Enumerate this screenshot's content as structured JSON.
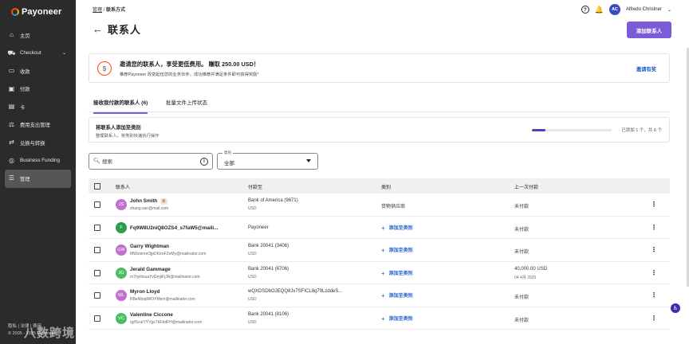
{
  "brand": {
    "name": "Payoneer"
  },
  "sidebar": {
    "items": [
      {
        "label": "主页",
        "icon": "home-icon",
        "glyph": "⌂"
      },
      {
        "label": "Checkout",
        "icon": "cart-icon",
        "glyph": "⛟",
        "chevron": "⌄"
      },
      {
        "label": "收款",
        "icon": "receive-icon",
        "glyph": "▭"
      },
      {
        "label": "付款",
        "icon": "pay-icon",
        "glyph": "▣"
      },
      {
        "label": "卡",
        "icon": "card-icon",
        "glyph": "▤"
      },
      {
        "label": "费用支出管理",
        "icon": "expense-icon",
        "glyph": "⚖"
      },
      {
        "label": "兑换与转换",
        "icon": "exchange-icon",
        "glyph": "⇄"
      },
      {
        "label": "Business Funding",
        "icon": "funding-icon",
        "glyph": "◎"
      },
      {
        "label": "管理",
        "icon": "manage-icon",
        "glyph": "☰"
      }
    ],
    "footer_line1": "隐私 | 法律 | 费用",
    "footer_line2": "© 2005 - 2025 Payoneer",
    "watermark": "八数跨境"
  },
  "breadcrumb": {
    "parent": "管理",
    "separator": " / ",
    "current": "联系方式"
  },
  "page_title": "联系人",
  "back_glyph": "←",
  "topbar": {
    "help": "?",
    "bell": "🔔",
    "avatar_initials": "AC",
    "user_name": "Alfredo Christner",
    "chevron": "⌄"
  },
  "add_contact_button": "添加联系人",
  "invite": {
    "title": "邀请您的联系人，享受更低费用。 赚取 250.00 USD！",
    "subtitle": "推荐Payoneer 改变起伍您的业务伙伴，成功推荐并满足条件即可获得奖励*",
    "link": "邀请有奖",
    "icon_glyph": "$"
  },
  "tabs": [
    {
      "label": "接收我付款的联系人 (6)",
      "active": true
    },
    {
      "label": "批量文件上传状态",
      "active": false
    }
  ],
  "category_card": {
    "title": "将联系人添加至类别",
    "subtitle": "整理联系人，将类别快速执行操作",
    "status": "已添加 1 个，共 6 个",
    "progress": 0.17
  },
  "search": {
    "placeholder": "搜索",
    "icon": "🔍",
    "info": "i"
  },
  "category_select": {
    "label": "类别",
    "value": "全部"
  },
  "table": {
    "headers": {
      "contact": "联系人",
      "pay_to": "付款至",
      "category": "类别",
      "last_payment": "上一次付款"
    },
    "add_category_label": "添加至类别",
    "more_glyph": "⋮",
    "rows": [
      {
        "initials": "JS",
        "avatar_color": "#c26fd1",
        "name": "John Smith",
        "badge": "新",
        "email": "zhang.san@mail.com",
        "pay_to": "Bank of America (9671)",
        "pay_sub": "USD",
        "category": "货物供应商",
        "last": "未付款",
        "last_sub": ""
      },
      {
        "initials": "F",
        "avatar_color": "#2e9c4e",
        "name": "Fq9W8U2niQ8OZS4_s7faW5@maili...",
        "badge": "",
        "email": "",
        "pay_to": "Payoneer",
        "pay_sub": "",
        "category": "",
        "last": "未付款",
        "last_sub": ""
      },
      {
        "initials": "GW",
        "avatar_color": "#c26fd1",
        "name": "Garry Wightman",
        "badge": "",
        "email": "MWzoimeOjpDKeoFZeMy@mailinator.com",
        "pay_to": "Bank 20041 (3406)",
        "pay_sub": "USD",
        "category": "",
        "last": "未付款",
        "last_sub": ""
      },
      {
        "initials": "JG",
        "avatar_color": "#4bbd63",
        "name": "Jerald Gammage",
        "badge": "",
        "email": "m7hyNouaYvGmjiFjJR@mailinator.com",
        "pay_to": "Bank 20041 (6706)",
        "pay_sub": "USD",
        "category": "",
        "last": "40,000.00 USD",
        "last_sub": "04 4月 2025"
      },
      {
        "initials": "ML",
        "avatar_color": "#c26fd1",
        "name": "Myron Lloyd",
        "badge": "",
        "email": "RBeNbqdWOYMvm@mailinator.com",
        "pay_to": "wQXDSDbOJEQQ8Jx7SFICL8q79LzddeS...",
        "pay_sub": "USD",
        "category": "",
        "last": "未付款",
        "last_sub": ""
      },
      {
        "initials": "VC",
        "avatar_color": "#4bbd63",
        "name": "Valentine Ciccone",
        "badge": "",
        "email": "qyfSvuiYYVgsTkEhdFH@mailinator.com",
        "pay_to": "Bank 20041 (8106)",
        "pay_sub": "USD",
        "category": "",
        "last": "未付款",
        "last_sub": ""
      }
    ]
  },
  "accessibility_glyph": "♿"
}
